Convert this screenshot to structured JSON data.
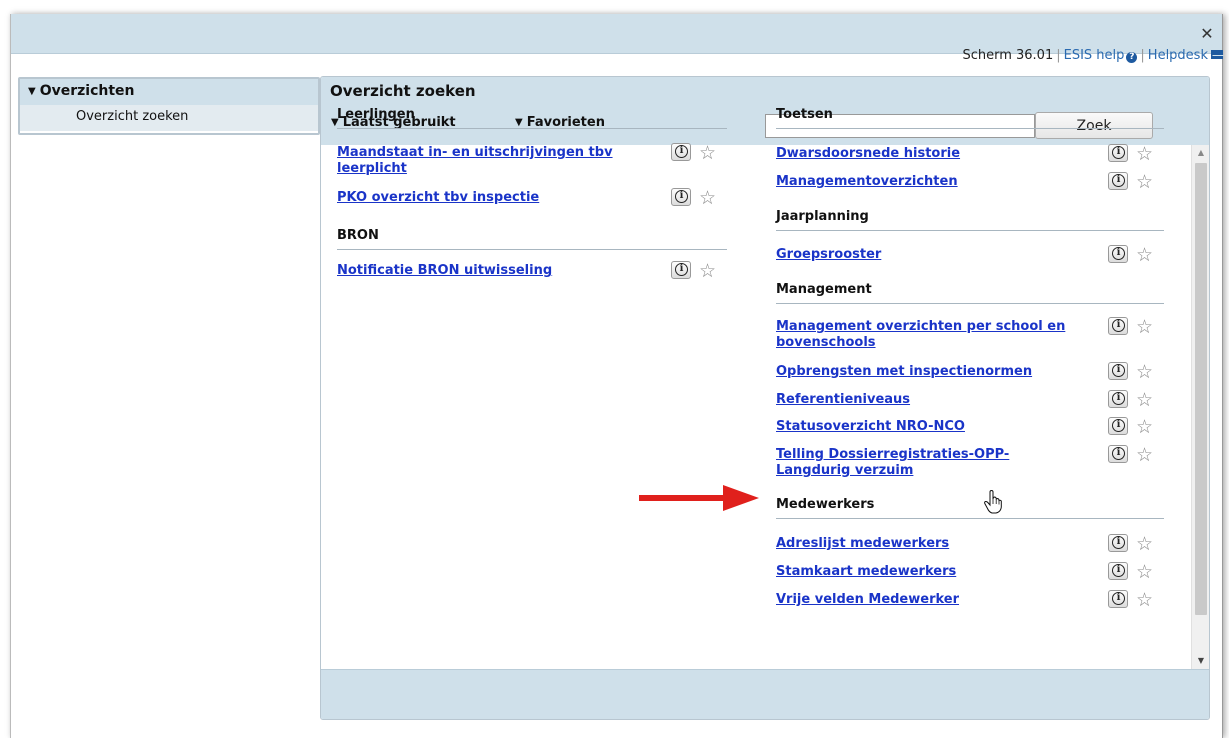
{
  "top": {
    "screen": "Scherm 36.01",
    "esis_help": "ESIS help",
    "helpdesk": "Helpdesk"
  },
  "sidebar": {
    "title": "Overzichten",
    "items": [
      {
        "label": "Overzicht zoeken"
      }
    ]
  },
  "main": {
    "title": "Overzicht zoeken",
    "tabs": [
      {
        "label": "Laatst gebruikt"
      },
      {
        "label": "Favorieten"
      }
    ],
    "search": {
      "value": "",
      "button": "Zoek"
    }
  },
  "left_sections": [
    {
      "title": "Leerlingen",
      "items": [
        "Maandstaat in- en uitschrijvingen tbv leerplicht",
        "PKO overzicht tbv inspectie"
      ]
    },
    {
      "title": "BRON",
      "items": [
        "Notificatie BRON uitwisseling"
      ]
    }
  ],
  "right_sections": [
    {
      "title": "Toetsen",
      "items": [
        "Dwarsdoorsnede historie",
        "Managementoverzichten"
      ]
    },
    {
      "title": "Jaarplanning",
      "items": [
        "Groepsrooster"
      ]
    },
    {
      "title": "Management",
      "items": [
        "Management overzichten per school en bovenschools",
        "Opbrengsten met inspectienormen",
        "Referentieniveaus",
        "Statusoverzicht NRO-NCO",
        "Telling Dossierregistraties-OPP-Langdurig verzuim"
      ]
    },
    {
      "title": "Medewerkers",
      "items": [
        "Adreslijst medewerkers",
        "Stamkaart medewerkers",
        "Vrije velden Medewerker"
      ]
    }
  ],
  "icons": {
    "info": "info-icon",
    "favorite": "star-outline-icon",
    "close": "close-icon"
  },
  "colors": {
    "header_bg": "#cfe0ea",
    "link": "#1a34c8",
    "arrow": "#e0201c"
  }
}
